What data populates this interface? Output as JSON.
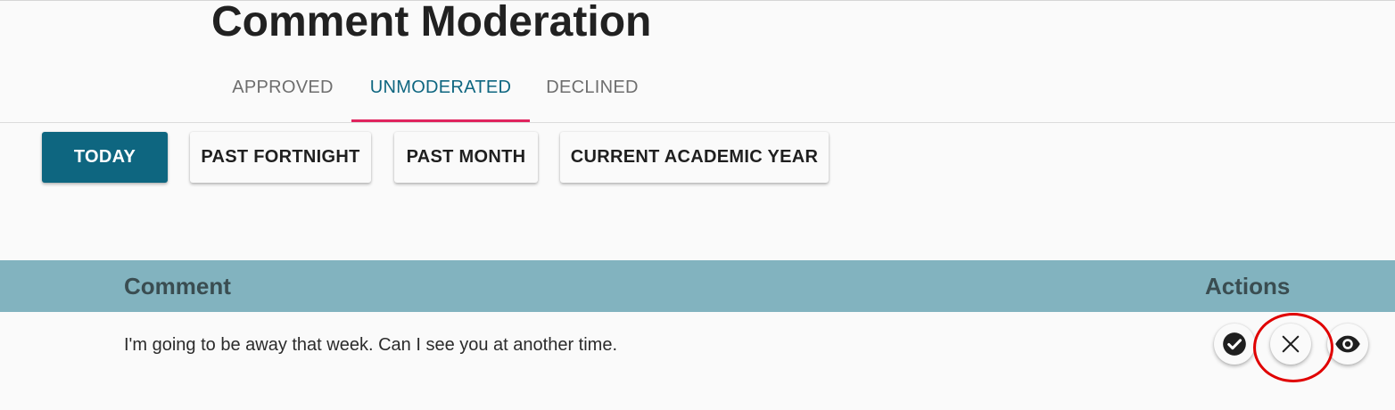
{
  "page": {
    "title": "Comment Moderation"
  },
  "tabs": [
    {
      "label": "APPROVED",
      "active": false
    },
    {
      "label": "UNMODERATED",
      "active": true
    },
    {
      "label": "DECLINED",
      "active": false
    }
  ],
  "filters": [
    {
      "label": "TODAY",
      "selected": true
    },
    {
      "label": "PAST FORTNIGHT",
      "selected": false
    },
    {
      "label": "PAST MONTH",
      "selected": false
    },
    {
      "label": "CURRENT ACADEMIC YEAR",
      "selected": false
    }
  ],
  "table": {
    "headers": {
      "comment": "Comment",
      "actions": "Actions"
    },
    "rows": [
      {
        "comment": "I'm going to be away that week. Can I see you at another time.",
        "actions": [
          "check-circle-icon",
          "close-icon",
          "eye-icon"
        ]
      }
    ]
  },
  "colors": {
    "primary": "#0e6680",
    "tab_indicator": "#e0245e",
    "table_header_bg": "#82b3bf",
    "highlight": "#e00000"
  }
}
